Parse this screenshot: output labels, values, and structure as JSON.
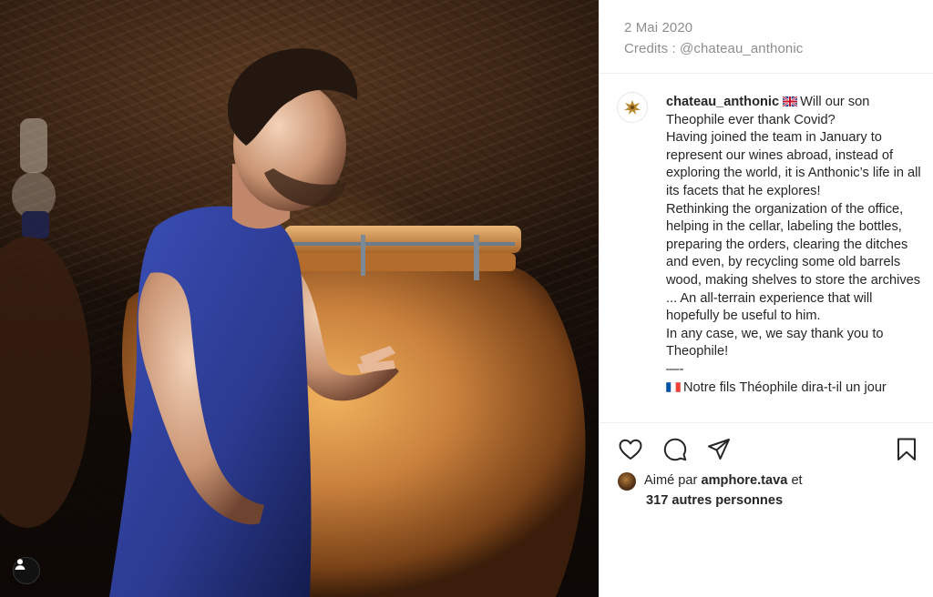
{
  "post": {
    "date": "2 Mai 2020",
    "credits": "Credits : @chateau_anthonic",
    "username": "chateau_anthonic",
    "caption_en_intro": "Will our son Theophile ever thank Covid?",
    "caption_en_p1": "Having joined the team in January to represent our wines abroad, instead of exploring the world, it is Anthonic’s life in all its facets that he explores!",
    "caption_en_p2": "Rethinking the organization of the office, helping in the cellar, labeling the bottles, preparing the orders, clearing the ditches and even, by recycling some old barrels wood, making shelves to store the archives ... An all-terrain experience that will hopefully be useful to him.",
    "caption_en_p3": "In any case, we, we say thank you to Theophile!",
    "caption_separator": "—-",
    "caption_fr_intro": "Notre fils Théophile dira-t-il un jour",
    "likes_prefix": "Aimé par",
    "liked_by_user": "amphore.tava",
    "likes_conjunction": "et",
    "likes_others": "317 autres personnes"
  },
  "icons": {
    "like": "heart-icon",
    "comment": "comment-icon",
    "share": "paper-plane-icon",
    "save": "bookmark-icon",
    "user": "user-icon",
    "flag_en": "uk-flag-icon",
    "flag_fr": "france-flag-icon"
  },
  "colors": {
    "text": "#262626",
    "meta": "#8e8e8e",
    "divider": "#efefef",
    "amphora": "#c9803c",
    "shirt": "#2b3a8f"
  }
}
